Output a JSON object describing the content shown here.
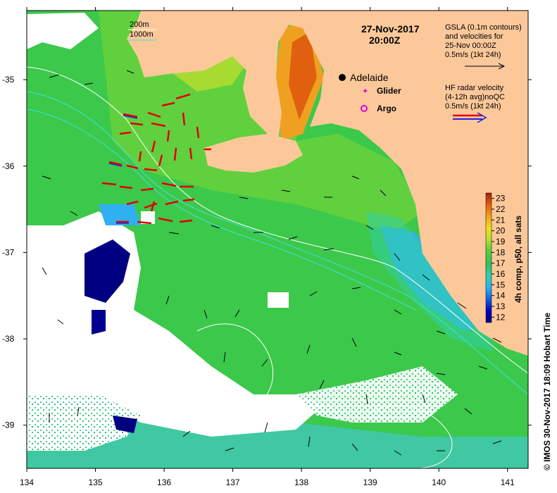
{
  "title": {
    "date": "27-Nov-2017",
    "time": "20:00Z"
  },
  "contour_legend": {
    "line1": "200m",
    "line2": "1000m",
    "color1": "#ffffff",
    "color2": "#40e0e0"
  },
  "places": {
    "adelaide": "Adelaide"
  },
  "markers": {
    "glider": "Glider",
    "argo": "Argo",
    "glider_color": "#e000e0",
    "argo_color": "#e000e0"
  },
  "gsla_legend": {
    "line1": "GSLA (0.1m contours)",
    "line2": "and velocities for",
    "line3": "25-Nov 00:00Z",
    "line4": "0.5m/s (1kt 24h)"
  },
  "hf_legend": {
    "line1": "HF radar velocity",
    "line2": "(4-12h avg)noQC",
    "line3": "0.5m/s (1kt 24h)",
    "color_red": "#e00000",
    "color_blue": "#2020e0"
  },
  "colorbar": {
    "title": "4h comp, p50, all sats",
    "ticks": [
      "12",
      "13",
      "14",
      "15",
      "16",
      "17",
      "18",
      "19",
      "20",
      "21",
      "22",
      "23"
    ],
    "range": [
      11.5,
      23.5
    ]
  },
  "axes": {
    "x_ticks": [
      "134",
      "135",
      "136",
      "137",
      "138",
      "139",
      "140",
      "141"
    ],
    "y_ticks": [
      "-35",
      "-36",
      "-37",
      "-38",
      "-39"
    ],
    "lon_range": [
      134,
      141.3
    ],
    "lat_range": [
      -39.5,
      -34.2
    ]
  },
  "credit": "© IMOS 30-Nov-2017 18:09 Hobart Time",
  "colors": {
    "land": "#fcc89a",
    "cloud": "#ffffff",
    "sea_green": "#3cc84a"
  }
}
